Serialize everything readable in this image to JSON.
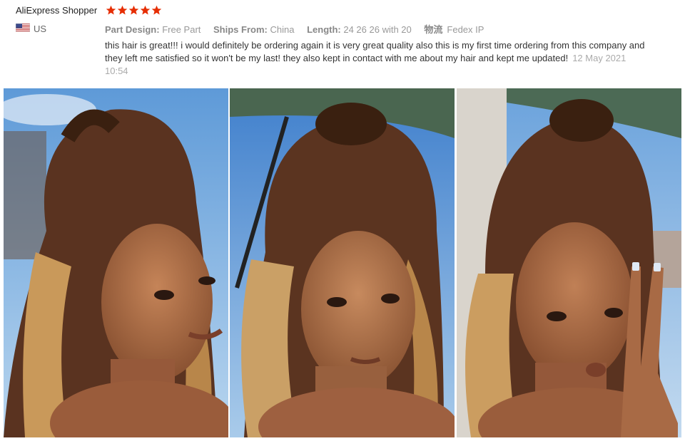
{
  "reviewer": {
    "name": "AliExpress Shopper",
    "rating": 5,
    "country": "US",
    "flag_icon": "us-flag-icon"
  },
  "attributes": {
    "part_design_label": "Part Design:",
    "part_design_value": "Free Part",
    "ships_from_label": "Ships From:",
    "ships_from_value": "China",
    "length_label": "Length:",
    "length_value": "24 26 26 with 20",
    "logistics_label": "物流",
    "logistics_value": "Fedex IP"
  },
  "review": {
    "text": "this hair is great!!! i would definitely be ordering again it is very great quality also this is my first time ordering from this company and they left me satisfied so it won't be my last! they also kept in contact with me about my hair and kept me updated!",
    "timestamp": "12 May 2021 10:54"
  },
  "photos": [
    {
      "name": "review-photo-1"
    },
    {
      "name": "review-photo-2"
    },
    {
      "name": "review-photo-3"
    }
  ],
  "colors": {
    "star": "#e62e04",
    "sky": "#7fb3e3",
    "skin": "#a86a45",
    "hair_dark": "#4a2a18",
    "hair_light": "#c9995a"
  }
}
